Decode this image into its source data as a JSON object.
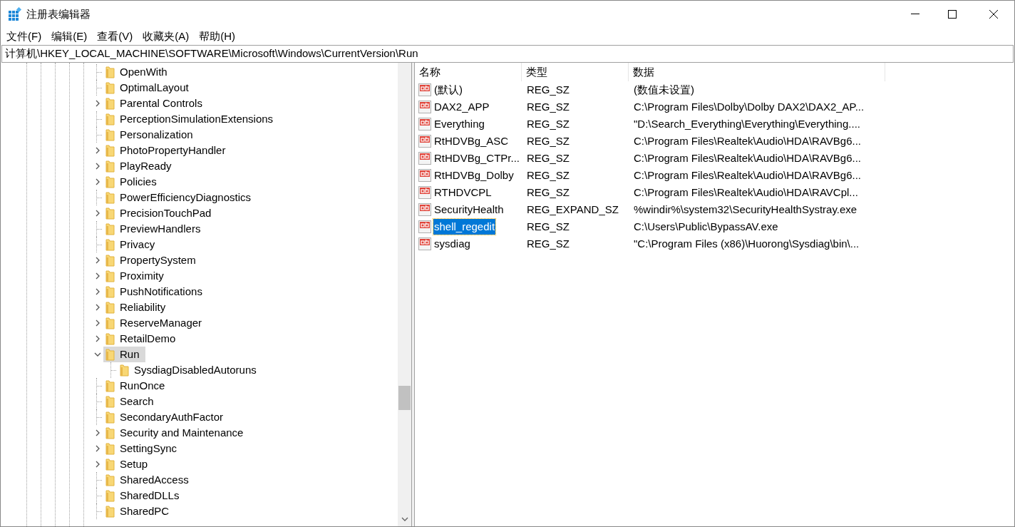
{
  "window": {
    "title": "注册表编辑器"
  },
  "menu": [
    "文件(F)",
    "编辑(E)",
    "查看(V)",
    "收藏夹(A)",
    "帮助(H)"
  ],
  "address": {
    "value": "计算机\\HKEY_LOCAL_MACHINE\\SOFTWARE\\Microsoft\\Windows\\CurrentVersion\\Run"
  },
  "tree": [
    {
      "label": "OpenWith",
      "kind": "leaf",
      "selected": false
    },
    {
      "label": "OptimalLayout",
      "kind": "leaf",
      "selected": false
    },
    {
      "label": "Parental Controls",
      "kind": "branch",
      "expanded": false,
      "selected": false
    },
    {
      "label": "PerceptionSimulationExtensions",
      "kind": "leaf",
      "selected": false
    },
    {
      "label": "Personalization",
      "kind": "leaf",
      "selected": false
    },
    {
      "label": "PhotoPropertyHandler",
      "kind": "branch",
      "expanded": false,
      "selected": false
    },
    {
      "label": "PlayReady",
      "kind": "branch",
      "expanded": false,
      "selected": false
    },
    {
      "label": "Policies",
      "kind": "branch",
      "expanded": false,
      "selected": false
    },
    {
      "label": "PowerEfficiencyDiagnostics",
      "kind": "leaf",
      "selected": false
    },
    {
      "label": "PrecisionTouchPad",
      "kind": "branch",
      "expanded": false,
      "selected": false
    },
    {
      "label": "PreviewHandlers",
      "kind": "leaf",
      "selected": false
    },
    {
      "label": "Privacy",
      "kind": "leaf",
      "selected": false
    },
    {
      "label": "PropertySystem",
      "kind": "branch",
      "expanded": false,
      "selected": false
    },
    {
      "label": "Proximity",
      "kind": "branch",
      "expanded": false,
      "selected": false
    },
    {
      "label": "PushNotifications",
      "kind": "branch",
      "expanded": false,
      "selected": false
    },
    {
      "label": "Reliability",
      "kind": "branch",
      "expanded": false,
      "selected": false
    },
    {
      "label": "ReserveManager",
      "kind": "branch",
      "expanded": false,
      "selected": false
    },
    {
      "label": "RetailDemo",
      "kind": "branch",
      "expanded": false,
      "selected": false
    },
    {
      "label": "Run",
      "kind": "branch",
      "expanded": true,
      "selected": true,
      "children": [
        {
          "label": "SysdiagDisabledAutoruns",
          "kind": "leaf",
          "selected": false
        }
      ]
    },
    {
      "label": "RunOnce",
      "kind": "leaf",
      "selected": false
    },
    {
      "label": "Search",
      "kind": "leaf",
      "selected": false
    },
    {
      "label": "SecondaryAuthFactor",
      "kind": "leaf",
      "selected": false
    },
    {
      "label": "Security and Maintenance",
      "kind": "branch",
      "expanded": false,
      "selected": false
    },
    {
      "label": "SettingSync",
      "kind": "branch",
      "expanded": false,
      "selected": false
    },
    {
      "label": "Setup",
      "kind": "branch",
      "expanded": false,
      "selected": false
    },
    {
      "label": "SharedAccess",
      "kind": "leaf",
      "selected": false
    },
    {
      "label": "SharedDLLs",
      "kind": "leaf",
      "selected": false
    },
    {
      "label": "SharedPC",
      "kind": "leaf",
      "selected": false
    }
  ],
  "table": {
    "columns": [
      "名称",
      "类型",
      "数据"
    ],
    "rows": [
      {
        "name": "(默认)",
        "type": "REG_SZ",
        "data": "(数值未设置)",
        "selected": false
      },
      {
        "name": "DAX2_APP",
        "type": "REG_SZ",
        "data": "C:\\Program Files\\Dolby\\Dolby DAX2\\DAX2_AP...",
        "selected": false
      },
      {
        "name": "Everything",
        "type": "REG_SZ",
        "data": "\"D:\\Search_Everything\\Everything\\Everything....",
        "selected": false
      },
      {
        "name": "RtHDVBg_ASC",
        "type": "REG_SZ",
        "data": "C:\\Program Files\\Realtek\\Audio\\HDA\\RAVBg6...",
        "selected": false
      },
      {
        "name": "RtHDVBg_CTPr...",
        "type": "REG_SZ",
        "data": "C:\\Program Files\\Realtek\\Audio\\HDA\\RAVBg6...",
        "selected": false
      },
      {
        "name": "RtHDVBg_Dolby",
        "type": "REG_SZ",
        "data": "C:\\Program Files\\Realtek\\Audio\\HDA\\RAVBg6...",
        "selected": false
      },
      {
        "name": "RTHDVCPL",
        "type": "REG_SZ",
        "data": "C:\\Program Files\\Realtek\\Audio\\HDA\\RAVCpl...",
        "selected": false
      },
      {
        "name": "SecurityHealth",
        "type": "REG_EXPAND_SZ",
        "data": "%windir%\\system32\\SecurityHealthSystray.exe",
        "selected": false
      },
      {
        "name": "shell_regedit",
        "type": "REG_SZ",
        "data": "C:\\Users\\Public\\BypassAV.exe",
        "selected": true
      },
      {
        "name": "sysdiag",
        "type": "REG_SZ",
        "data": "\"C:\\Program Files (x86)\\Huorong\\Sysdiag\\bin\\...",
        "selected": false
      }
    ]
  }
}
